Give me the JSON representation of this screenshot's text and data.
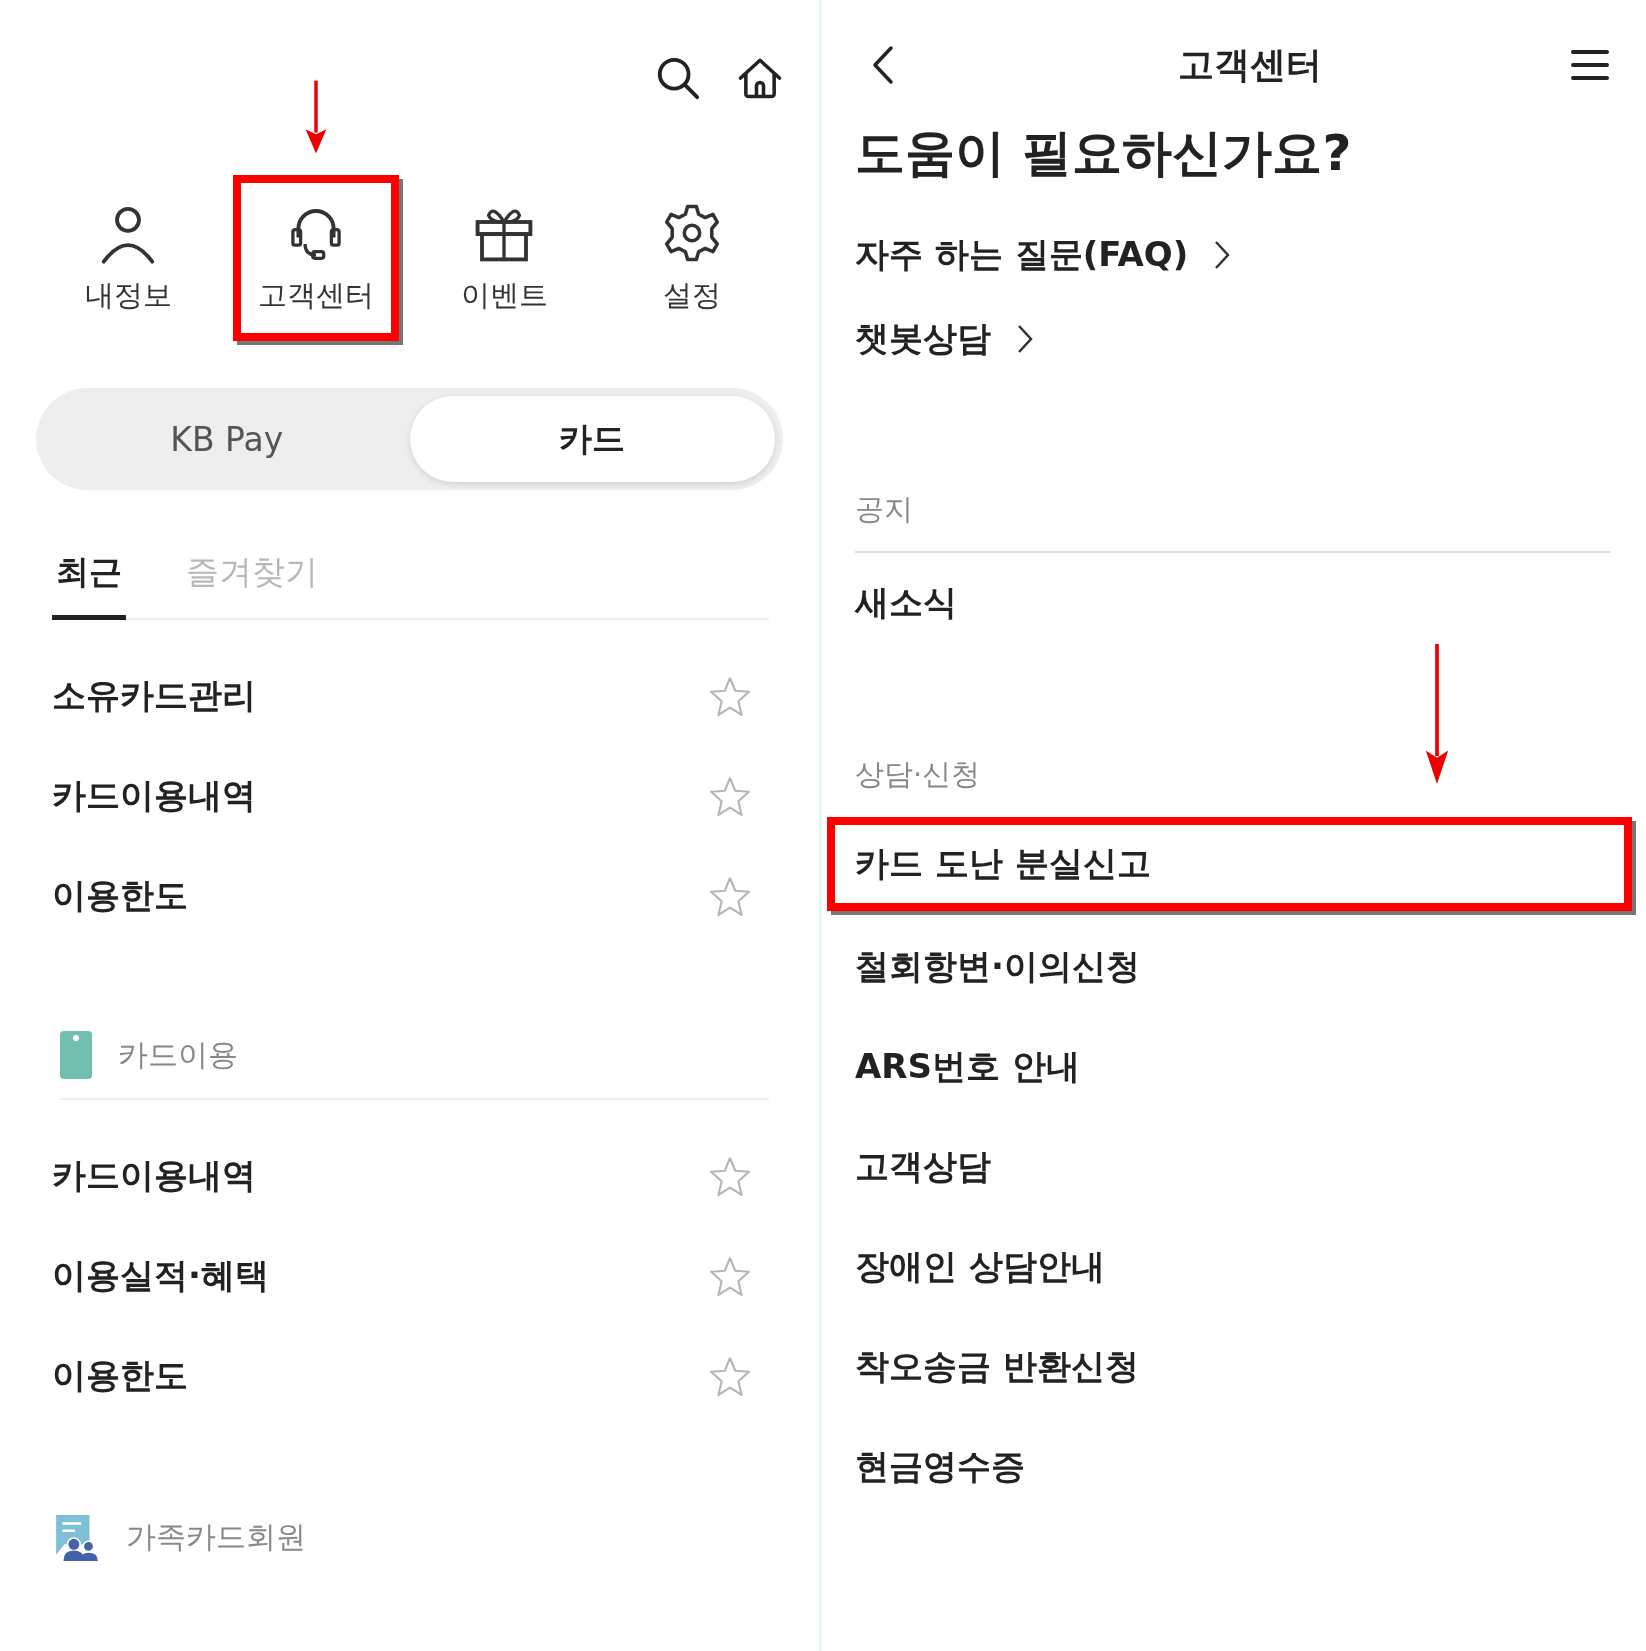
{
  "left": {
    "quick_menu": [
      {
        "label": "내정보",
        "kind": "person",
        "highlighted": false
      },
      {
        "label": "고객센터",
        "kind": "headset",
        "highlighted": true
      },
      {
        "label": "이벤트",
        "kind": "gift",
        "highlighted": false
      },
      {
        "label": "설정",
        "kind": "gear",
        "highlighted": false
      }
    ],
    "segments": [
      {
        "label": "KB Pay",
        "selected": false
      },
      {
        "label": "카드",
        "selected": true
      }
    ],
    "tabs": [
      {
        "label": "최근",
        "selected": true
      },
      {
        "label": "즐겨찾기",
        "selected": false
      }
    ],
    "recent": [
      {
        "label": "소유카드관리",
        "favorite": false
      },
      {
        "label": "카드이용내역",
        "favorite": false
      },
      {
        "label": "이용한도",
        "favorite": false
      }
    ],
    "sections": [
      {
        "title": "카드이용",
        "kind": "card",
        "items": [
          {
            "label": "카드이용내역",
            "favorite": false
          },
          {
            "label": "이용실적·혜택",
            "favorite": false
          },
          {
            "label": "이용한도",
            "favorite": false
          }
        ]
      },
      {
        "title": "가족카드회원",
        "kind": "family"
      }
    ]
  },
  "right": {
    "title": "고객센터",
    "heading": "도움이 필요하신가요?",
    "links": [
      "자주 하는 질문(FAQ)",
      "챗봇상담"
    ],
    "groups": [
      {
        "title": "공지",
        "divider": true,
        "items": [
          {
            "label": "새소식",
            "highlighted": false
          }
        ]
      },
      {
        "title": "상담·신청",
        "divider": false,
        "items": [
          {
            "label": "카드 도난 분실신고",
            "highlighted": true
          },
          {
            "label": "철회항변·이의신청",
            "highlighted": false
          },
          {
            "label": "ARS번호 안내",
            "highlighted": false
          },
          {
            "label": "고객상담",
            "highlighted": false
          },
          {
            "label": "장애인 상담안내",
            "highlighted": false
          },
          {
            "label": "착오송금 반환신청",
            "highlighted": false
          },
          {
            "label": "현금영수증",
            "highlighted": false
          }
        ]
      }
    ]
  }
}
